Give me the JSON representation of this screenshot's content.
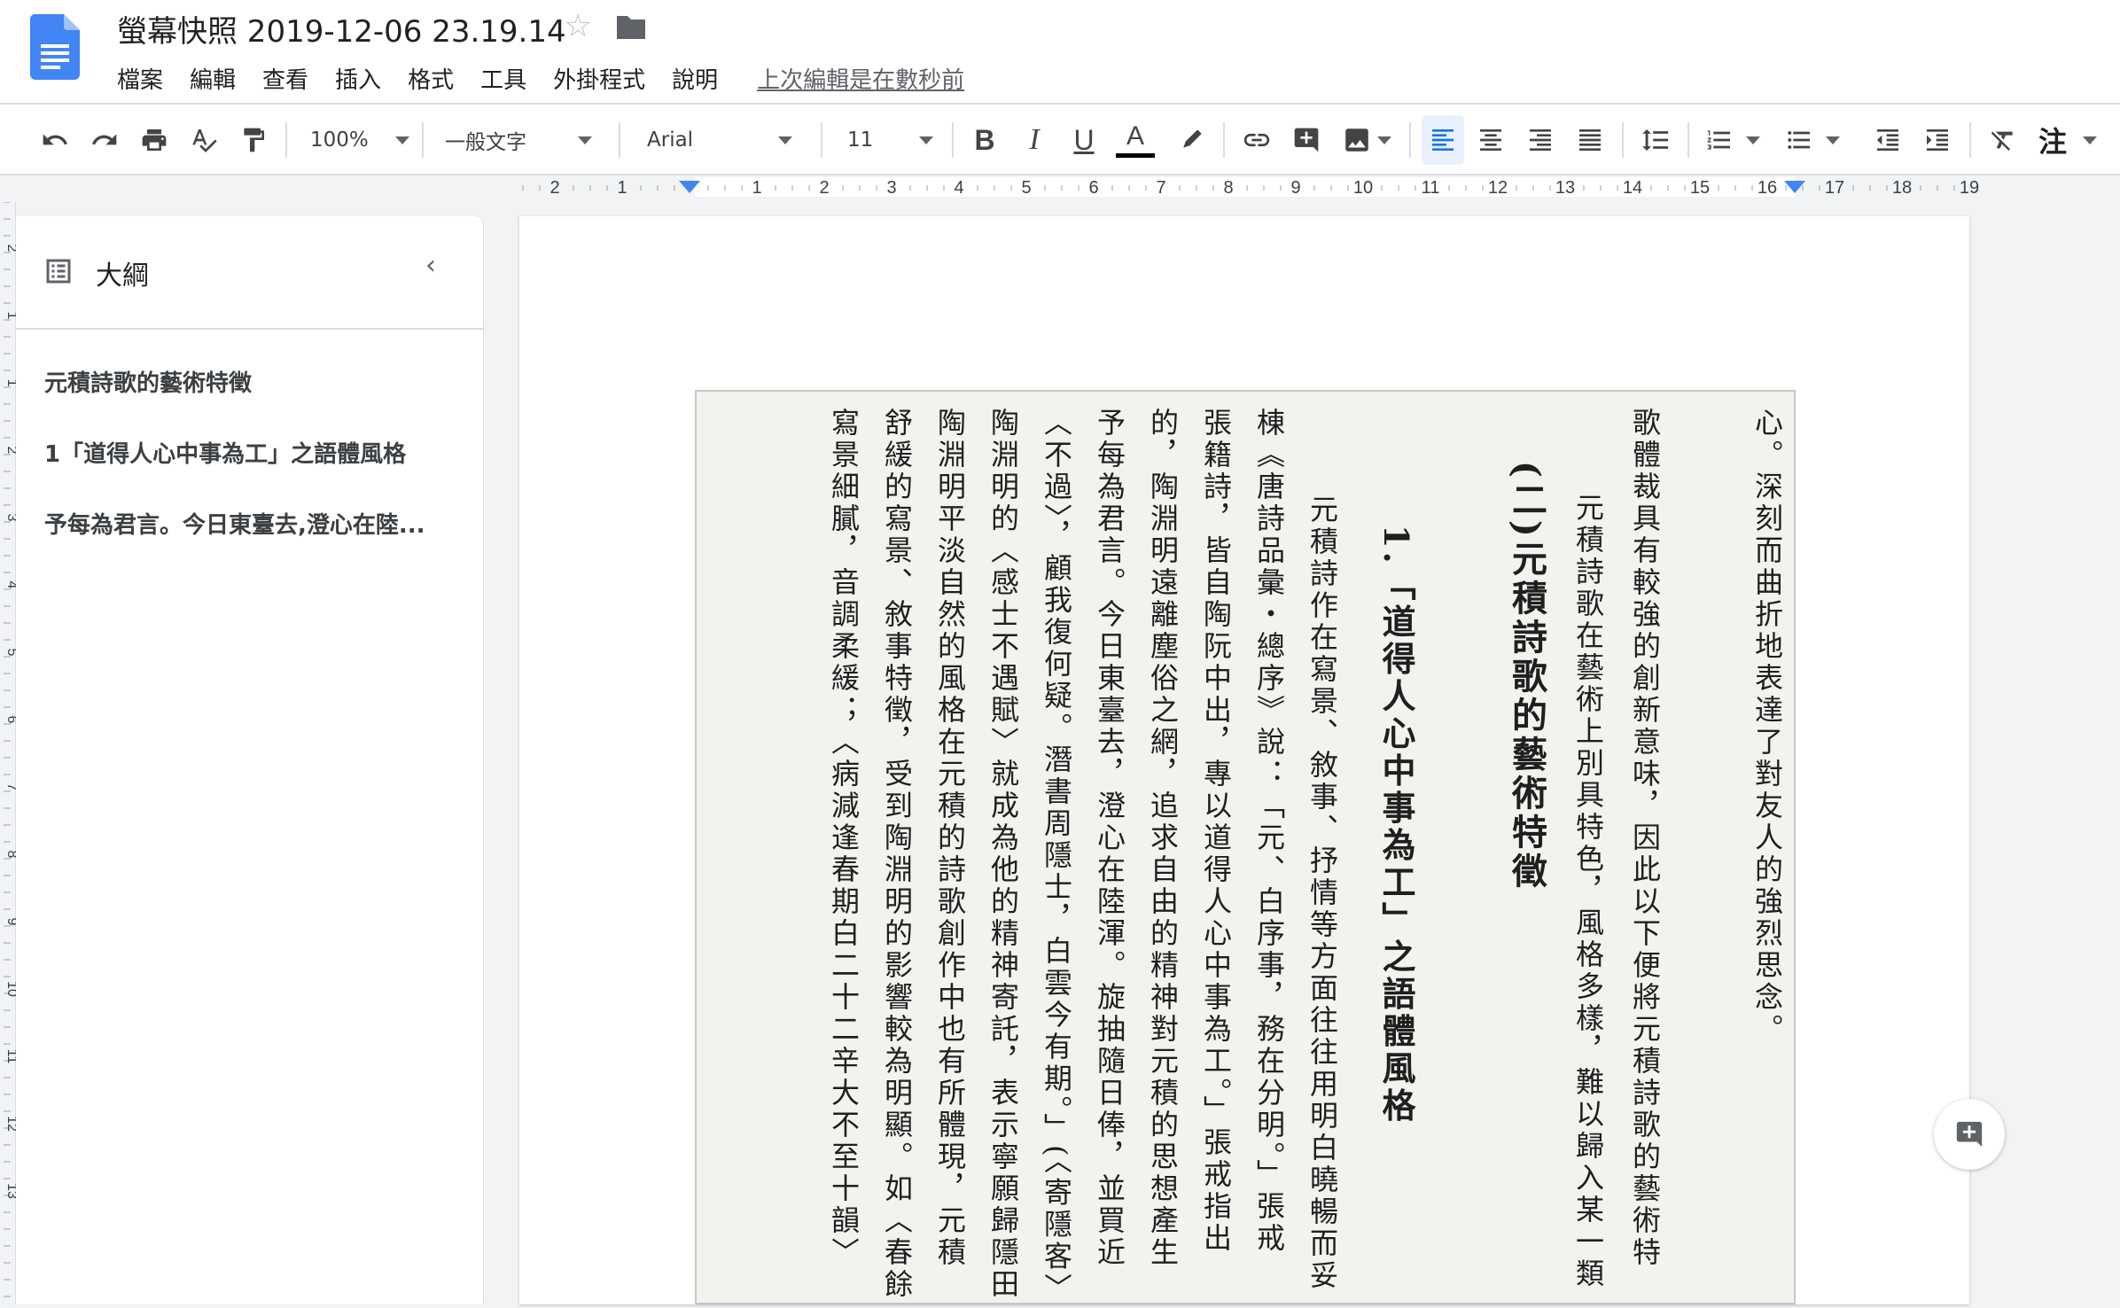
{
  "header": {
    "title": "螢幕快照 2019-12-06 23.19.14",
    "menu": [
      "檔案",
      "編輯",
      "查看",
      "插入",
      "格式",
      "工具",
      "外掛程式",
      "說明"
    ],
    "last_edit": "上次編輯是在數秒前"
  },
  "toolbar": {
    "zoom": "100%",
    "style": "一般文字",
    "font": "Arial",
    "font_size": "11",
    "text_color": "#000000",
    "more_label": "注"
  },
  "ruler": {
    "labels": [
      "2",
      "1",
      "1",
      "2",
      "3",
      "4",
      "5",
      "6",
      "7",
      "8",
      "9",
      "10",
      "11",
      "12",
      "13",
      "14",
      "15",
      "16",
      "17",
      "18",
      "19"
    ]
  },
  "vruler": {
    "labels": [
      "2",
      "1",
      "1",
      "2",
      "3",
      "4",
      "5",
      "6",
      "7",
      "8",
      "9",
      "10",
      "11",
      "12",
      "13"
    ]
  },
  "outline": {
    "title": "大綱",
    "items": [
      "元積詩歌的藝術特徵",
      "1「道得人心中事為工」之語體風格",
      "予每為君言。今日東臺去,澄心在陸..."
    ]
  },
  "scan": {
    "columns": [
      "心。深刻而曲折地表達了對友人的強烈思念。",
      "",
      "歌體裁具有較強的創新意味，因此以下便將元積詩歌的藝術特",
      "　元積詩歌在藝術上別具特色，風格多樣，難以歸入某一類",
      "(二)元積詩歌的藝術特徵",
      "",
      "1.「道得人心中事為工」之語體風格",
      "",
      "　元積詩作在寫景、敘事、抒情等方面往往用明白曉暢而妥",
      "棟《唐詩品彙・總序》說：「元、白序事，務在分明。」張戒",
      "張籍詩，皆自陶阮中出，專以道得人心中事為工。」張戒指出",
      "的，陶淵明遠離塵俗之網，追求自由的精神對元積的思想產生",
      "予每為君言。今日東臺去，澄心在陸渾。旋抽隨日俸，並買近",
      "〈不過〉，顧我復何疑。潛書周隱士，白雲今有期。」(〈寄隱客〉",
      "陶淵明的〈感士不遇賦〉就成為他的精神寄託，表示寧願歸隱田",
      "陶淵明平淡自然的風格在元積的詩歌創作中也有所體現，元積",
      "舒緩的寫景、敘事特徵，受到陶淵明的影響較為明顯。如〈春餘",
      "寫景細膩，音調柔緩；〈病減逢春期白二十二辛大不至十韻〉"
    ]
  }
}
